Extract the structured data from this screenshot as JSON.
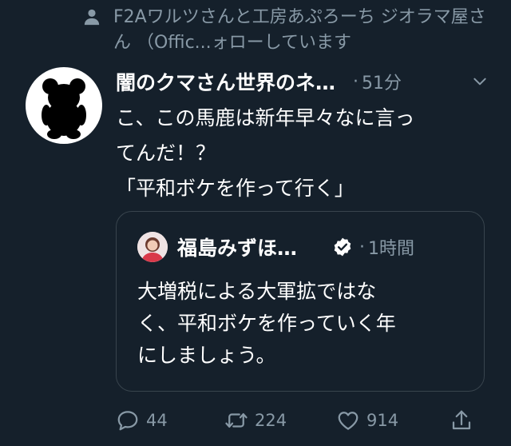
{
  "context": {
    "text": "F2Aワルツさんと工房あぷろーち ジオラマ屋さん （Offic...ォローしています",
    "icon": "person-icon"
  },
  "tweet": {
    "author_name": "闇のクマさん世界のネ…",
    "dot": "·",
    "time": "51分",
    "body_lines": [
      "こ、この馬鹿は新年早々なに言っ",
      "てんだ！？",
      "「平和ボケを作って行く」"
    ]
  },
  "quote": {
    "author_name": "福島みずほ…",
    "dot": "·",
    "time": "1時間",
    "body_lines": [
      "大増税による大軍拡ではな",
      "く、平和ボケを作っていく年",
      "にしましょう。"
    ]
  },
  "actions": {
    "reply_count": "44",
    "retweet_count": "224",
    "like_count": "914"
  },
  "colors": {
    "background": "#15202b",
    "text": "#ffffff",
    "muted": "#8899a6",
    "border": "#38444d"
  }
}
